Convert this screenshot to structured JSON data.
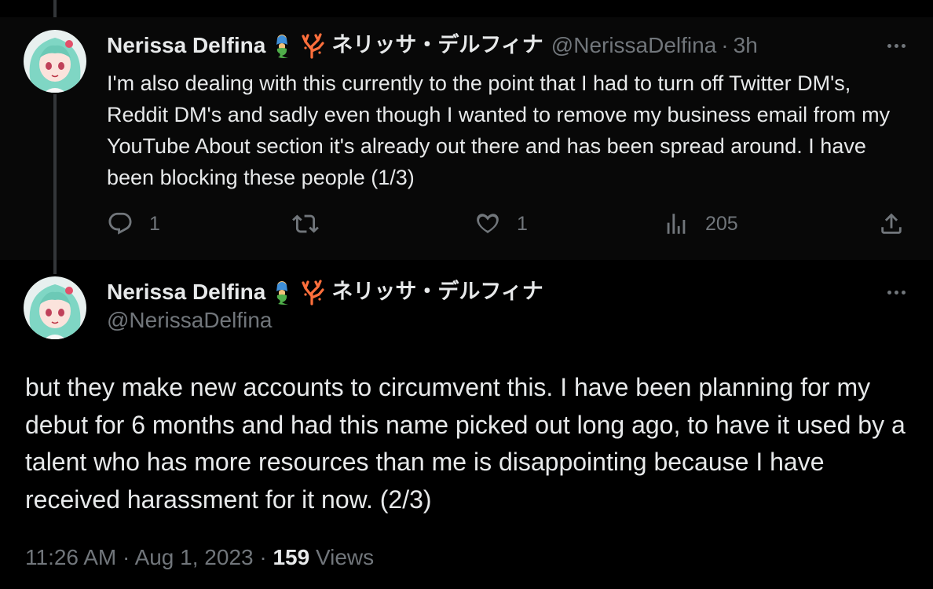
{
  "tweet1": {
    "author_name": "Nerissa Delfina",
    "author_jp": "ネリッサ・デルフィナ",
    "handle": "@NerissaDelfina",
    "separator": "·",
    "time_ago": "3h",
    "text": "I'm also dealing with this currently to the point that I had to turn off Twitter DM's, Reddit DM's and sadly even though I wanted to remove my business email from my YouTube About section it's already out there and has been spread around. I have been blocking these people (1/3)",
    "reply_count": "1",
    "like_count": "1",
    "views_count": "205",
    "icons": [
      "reply-icon",
      "retweet-icon",
      "like-icon",
      "views-icon",
      "share-icon",
      "more-icon"
    ]
  },
  "tweet2": {
    "author_name": "Nerissa Delfina",
    "author_jp": "ネリッサ・デルフィナ",
    "handle": "@NerissaDelfina",
    "text": "but they make new accounts to circumvent this. I have been planning for my debut for 6 months and had this name picked out long ago, to have it used by a talent who has more resources than me is disappointing because I have received harassment for it now. (2/3)",
    "timestamp": "11:26 AM · Aug 1, 2023 · ",
    "views_number": "159",
    "views_label": " Views"
  },
  "colors": {
    "background": "#000000",
    "highlight_background": "#080808",
    "text": "#e7e9ea",
    "secondary_text": "#71767b",
    "thread_line": "#333639"
  }
}
